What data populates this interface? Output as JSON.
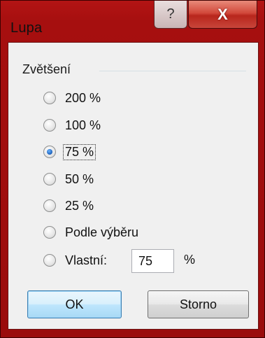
{
  "window": {
    "title": "Lupa",
    "help_glyph": "?",
    "close_glyph": "X"
  },
  "zoom_group": {
    "label": "Zvětšení",
    "options": [
      {
        "label": "200 %",
        "checked": false
      },
      {
        "label": "100 %",
        "checked": false
      },
      {
        "label": "75 %",
        "checked": true
      },
      {
        "label": "50 %",
        "checked": false
      },
      {
        "label": "25 %",
        "checked": false
      },
      {
        "label": "Podle výběru",
        "checked": false
      },
      {
        "label": "Vlastní:",
        "checked": false
      }
    ],
    "custom_value": "75",
    "custom_unit": "%"
  },
  "buttons": {
    "ok": "OK",
    "cancel": "Storno"
  },
  "colors": {
    "frame": "#a60f0f",
    "close_button": "#c8453a",
    "selected_radio": "#1c5fb8"
  }
}
